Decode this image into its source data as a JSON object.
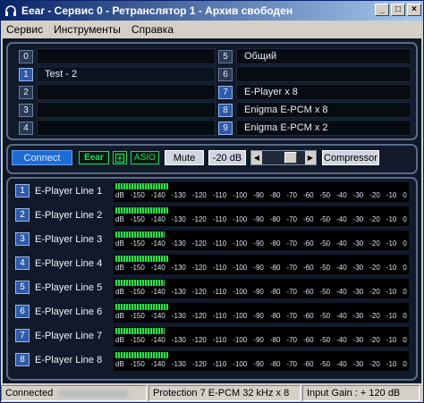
{
  "window": {
    "title": "Eear - Сервис 0 - Ретранслятор 1 - Архив свободен",
    "icon": "headphones-icon",
    "minimize": "_",
    "maximize": "□",
    "close": "×"
  },
  "menu": {
    "items": [
      "Сервис",
      "Инструменты",
      "Справка"
    ]
  },
  "channels_left": [
    {
      "num": "0",
      "name": "",
      "active": false
    },
    {
      "num": "1",
      "name": "Test - 2",
      "active": true
    },
    {
      "num": "2",
      "name": "",
      "active": false
    },
    {
      "num": "3",
      "name": "",
      "active": false
    },
    {
      "num": "4",
      "name": "",
      "active": false
    }
  ],
  "channels_right": [
    {
      "num": "5",
      "name": "Общий",
      "active": false
    },
    {
      "num": "6",
      "name": "",
      "active": false
    },
    {
      "num": "7",
      "name": "E-Player x 8",
      "active": true
    },
    {
      "num": "8",
      "name": "Enigma E-PCM x 8",
      "active": false
    },
    {
      "num": "9",
      "name": "Enigma E-PCM x 2",
      "active": false
    }
  ],
  "controls": {
    "connect": "Connect",
    "ear_tag": "Eear",
    "sync_icon": "sync-icon",
    "asio_tag": "ASIO",
    "mute": "Mute",
    "gain": "-20 dB",
    "slider_left": "◀",
    "slider_right": "▶",
    "slider_level": 0.7,
    "compressor": "Compressor"
  },
  "lines": [
    {
      "num": "1",
      "name": "E-Player Line 1",
      "level": 0.18
    },
    {
      "num": "2",
      "name": "E-Player Line 2",
      "level": 0.18
    },
    {
      "num": "3",
      "name": "E-Player Line 3",
      "level": 0.17
    },
    {
      "num": "4",
      "name": "E-Player Line 4",
      "level": 0.18
    },
    {
      "num": "5",
      "name": "E-Player Line 5",
      "level": 0.17
    },
    {
      "num": "6",
      "name": "E-Player Line 6",
      "level": 0.18
    },
    {
      "num": "7",
      "name": "E-Player Line 7",
      "level": 0.17
    },
    {
      "num": "8",
      "name": "E-Player Line 8",
      "level": 0.18
    }
  ],
  "scale_labels": [
    "dB",
    "-150",
    "-140",
    "-130",
    "-120",
    "-110",
    "-100",
    "-90",
    "-80",
    "-70",
    "-60",
    "-50",
    "-40",
    "-30",
    "-20",
    "-10",
    "0"
  ],
  "status": {
    "connected": "Connected",
    "protection": "Protection 7 E-PCM 32 kHz x 8",
    "input_gain": "Input Gain : + 120 dB"
  }
}
